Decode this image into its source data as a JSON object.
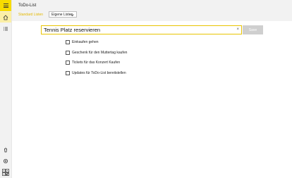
{
  "app": {
    "title": "ToDo-List"
  },
  "tabs": {
    "standard": "Standard Listen",
    "own": "Eigene Listen"
  },
  "input": {
    "value": "Tennis Platz reservieren",
    "clear_glyph": "×"
  },
  "save_label": "Save",
  "todos": [
    {
      "label": "Einkaufen gehen",
      "checked": false
    },
    {
      "label": "Geschenk für den Muttertag kaufen",
      "checked": false
    },
    {
      "label": "Tickets für das Konzert Kaufen",
      "checked": false
    },
    {
      "label": "Updates für ToDo-List bereitstellen",
      "checked": false
    }
  ],
  "rail": {
    "icons": [
      "menu-icon",
      "home-icon",
      "list-icon",
      "bucket-icon",
      "settings-icon",
      "qr-code-icon"
    ],
    "accent": "#f7dc00"
  }
}
